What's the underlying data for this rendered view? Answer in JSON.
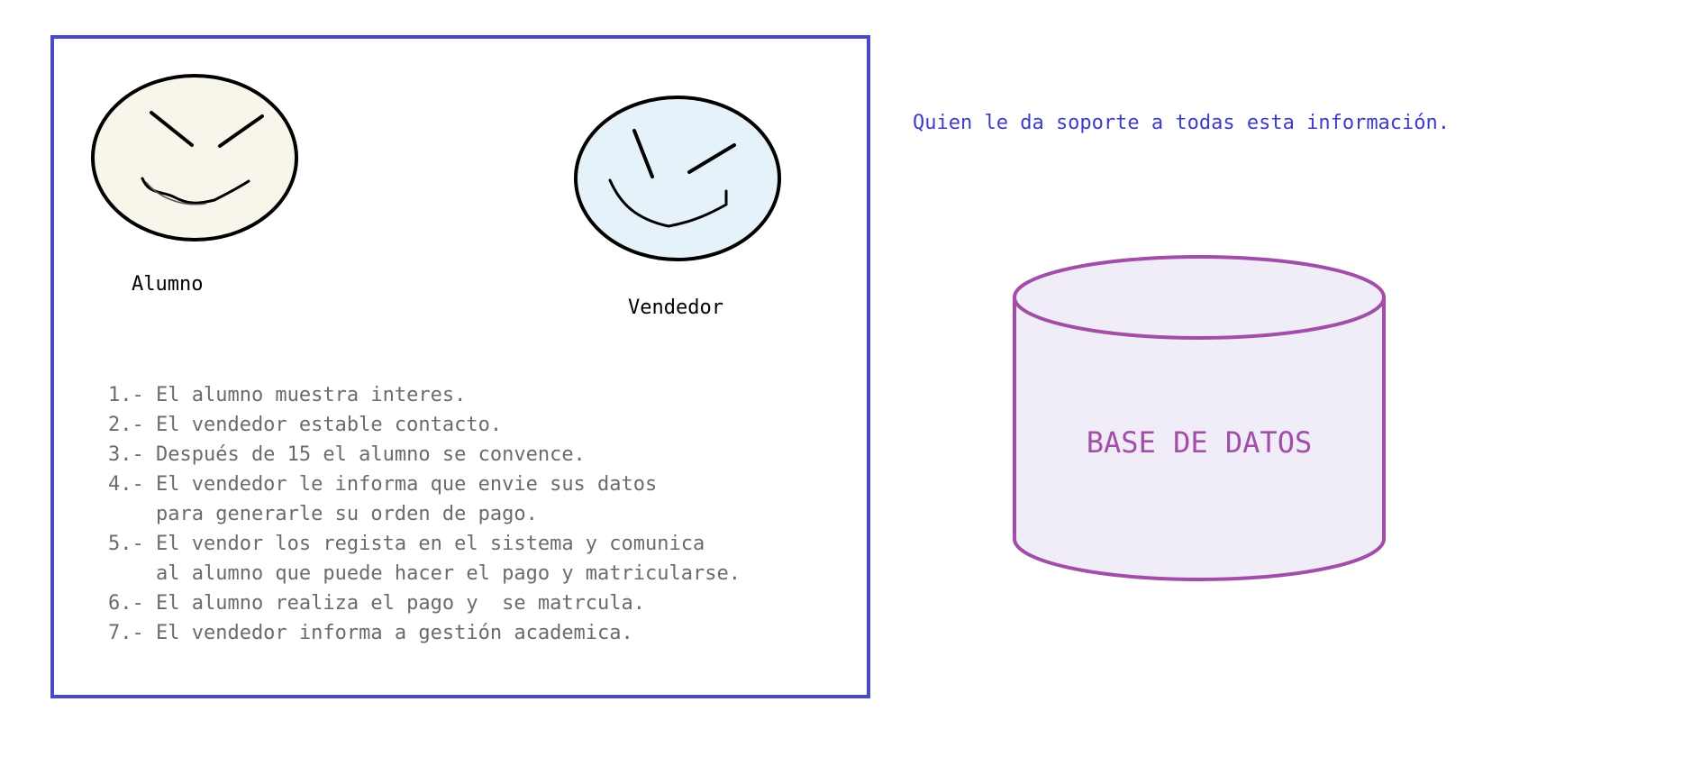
{
  "actors": {
    "alumno": "Alumno",
    "vendedor": "Vendedor"
  },
  "steps": [
    [
      "1.- El alumno muestra interes."
    ],
    [
      "2.- El vendedor estable contacto."
    ],
    [
      "3.- Después de 15 el alumno se convence."
    ],
    [
      "4.- El vendedor le informa que envie sus datos",
      "    para generarle su orden de pago."
    ],
    [
      "5.- El vendor los regista en el sistema y comunica",
      "    al alumno que puede hacer el pago y matricularse."
    ],
    [
      "6.- El alumno realiza el pago y  se matrcula."
    ],
    [
      "7.- El vendedor informa a gestión academica."
    ]
  ],
  "question": "Quien le da soporte a todas esta información.",
  "database_label": "BASE DE DATOS",
  "colors": {
    "frame": "#4a4ac6",
    "question_text": "#3d3dc8",
    "step_text": "#6b6b6b",
    "alumno_face": "#f8f6ea",
    "vendedor_face": "#e6f2f9",
    "database_stroke": "#a24ea8",
    "database_fill": "#f0ecf8",
    "database_text": "#a24ea8"
  },
  "icons": {
    "alumno": "smiley-face-icon",
    "vendedor": "smiley-face-icon",
    "database": "database-cylinder-icon"
  }
}
